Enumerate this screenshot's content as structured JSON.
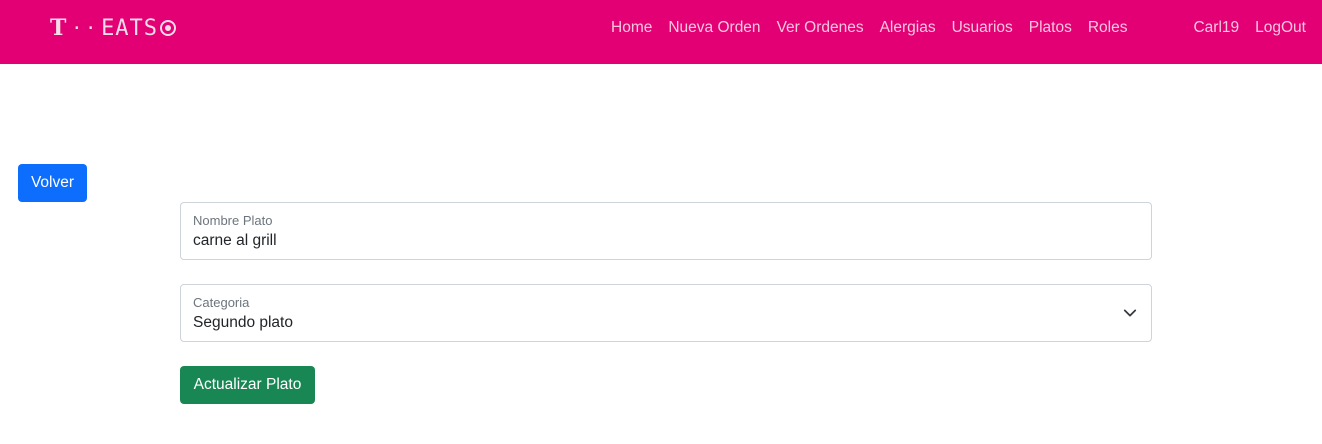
{
  "navbar": {
    "brand": {
      "letter": "T",
      "dots": "··",
      "text": "EATS",
      "badge_icon": "circle-badge-icon"
    },
    "links": [
      "Home",
      "Nueva Orden",
      "Ver Ordenes",
      "Alergias",
      "Usuarios",
      "Platos",
      "Roles"
    ],
    "user": "Carl19",
    "logout": "LogOut",
    "background_color": "#e20074"
  },
  "actions": {
    "back_label": "Volver",
    "update_label": "Actualizar Plato"
  },
  "form": {
    "name": {
      "label": "Nombre Plato",
      "value": "carne al grill"
    },
    "category": {
      "label": "Categoria",
      "selected": "Segundo plato",
      "icon": "chevron-down-icon"
    }
  },
  "colors": {
    "primary": "#0d6efd",
    "success": "#198754"
  }
}
